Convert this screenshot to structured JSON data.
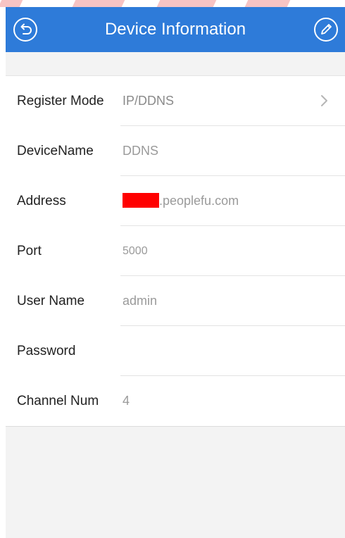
{
  "header": {
    "title": "Device Information",
    "back_icon": "back-arrow-icon",
    "edit_icon": "pencil-icon",
    "bg_color": "#2e7bd9"
  },
  "form": {
    "rows": [
      {
        "label": "Register Mode",
        "value": "IP/DDNS",
        "has_chevron": true
      },
      {
        "label": "DeviceName",
        "value": "DDNS"
      },
      {
        "label": "Address",
        "value": ".peoplefu.com",
        "redacted_prefix": true
      },
      {
        "label": "Port",
        "value": "5000"
      },
      {
        "label": "User Name",
        "value": "admin"
      },
      {
        "label": "Password",
        "value": ""
      },
      {
        "label": "Channel Num",
        "value": "4"
      }
    ]
  }
}
